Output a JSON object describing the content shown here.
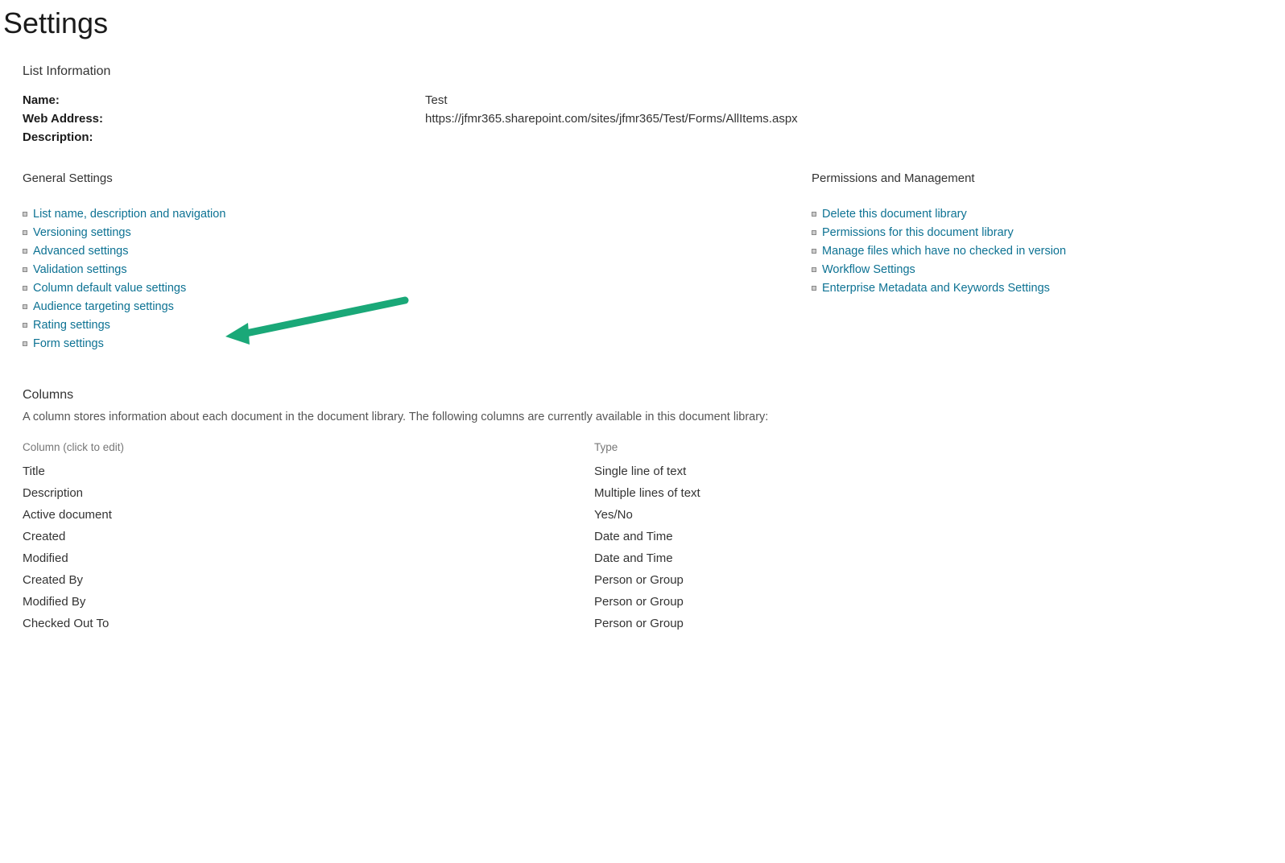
{
  "page_title": "Settings",
  "list_information": {
    "heading": "List Information",
    "rows": [
      {
        "label": "Name:",
        "value": "Test"
      },
      {
        "label": "Web Address:",
        "value": "https://jfmr365.sharepoint.com/sites/jfmr365/Test/Forms/AllItems.aspx"
      },
      {
        "label": "Description:",
        "value": ""
      }
    ]
  },
  "general_settings": {
    "heading": "General Settings",
    "links": [
      "List name, description and navigation",
      "Versioning settings",
      "Advanced settings",
      "Validation settings",
      "Column default value settings",
      "Audience targeting settings",
      "Rating settings",
      "Form settings"
    ]
  },
  "permissions_mgmt": {
    "heading": "Permissions and Management",
    "links": [
      "Delete this document library",
      "Permissions for this document library",
      "Manage files which have no checked in version",
      "Workflow Settings",
      "Enterprise Metadata and Keywords Settings"
    ]
  },
  "columns_section": {
    "heading": "Columns",
    "description": "A column stores information about each document in the document library. The following columns are currently available in this document library:",
    "header_name": "Column (click to edit)",
    "header_type": "Type",
    "columns": [
      {
        "name": "Title",
        "type": "Single line of text"
      },
      {
        "name": "Description",
        "type": "Multiple lines of text"
      },
      {
        "name": "Active document",
        "type": "Yes/No"
      },
      {
        "name": "Created",
        "type": "Date and Time"
      },
      {
        "name": "Modified",
        "type": "Date and Time"
      },
      {
        "name": "Created By",
        "type": "Person or Group"
      },
      {
        "name": "Modified By",
        "type": "Person or Group"
      },
      {
        "name": "Checked Out To",
        "type": "Person or Group"
      }
    ]
  },
  "annotation": {
    "arrow_color": "#1aa878"
  }
}
